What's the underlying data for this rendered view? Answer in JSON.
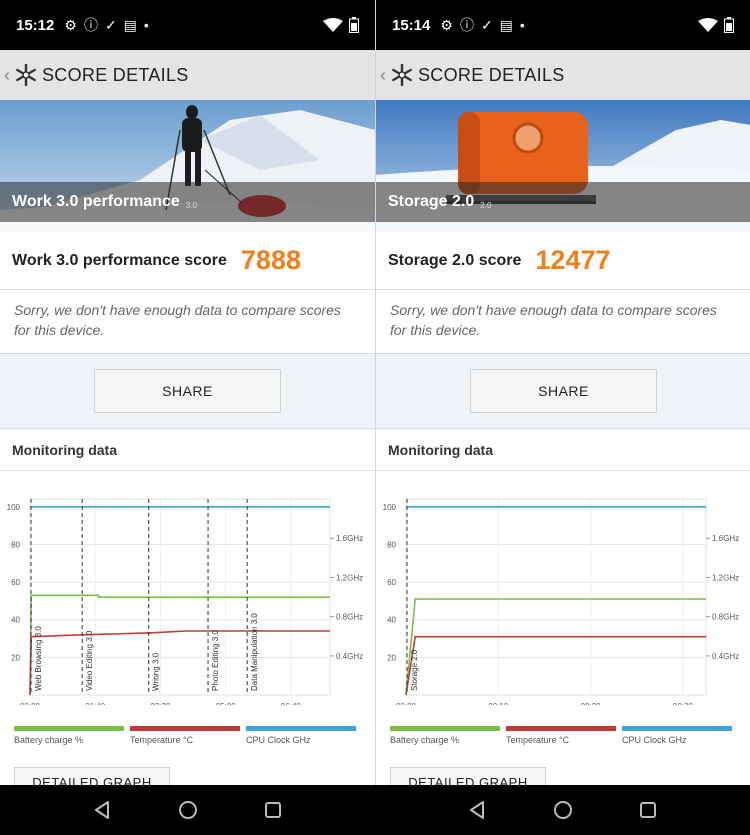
{
  "screens": [
    {
      "status": {
        "time": "15:12"
      },
      "appbar": {
        "title": "SCORE DETAILS"
      },
      "hero": {
        "name": "Work 3.0 performance",
        "version": "3.0"
      },
      "score": {
        "label": "Work 3.0 performance score",
        "value": "7888"
      },
      "compare_text": "Sorry, we don't have enough data to compare scores for this device.",
      "share_label": "SHARE",
      "monitoring": {
        "title": "Monitoring data",
        "detail_label": "DETAILED GRAPH"
      },
      "legend": [
        "Battery charge %",
        "Temperature °C",
        "CPU Clock GHz"
      ],
      "chart_data": {
        "type": "line",
        "x_ticks": [
          "00:00",
          "01:40",
          "03:20",
          "05:00",
          "06:40"
        ],
        "x_max_seconds": 460,
        "y_left_ticks": [
          "20",
          "40",
          "60",
          "80",
          "100"
        ],
        "y_right_ticks": [
          "0.4GHz",
          "0.8GHz",
          "1.2GHz",
          "1.6GHz"
        ],
        "ylim_left": [
          0,
          100
        ],
        "ylim_right_ghz": [
          0,
          2.0
        ],
        "markers": [
          {
            "label": "Web Browsing 3.0",
            "t": 0
          },
          {
            "label": "Video Editing 3.0",
            "t": 80
          },
          {
            "label": "Writing 3.0",
            "t": 182
          },
          {
            "label": "Photo Editing 3.0",
            "t": 273
          },
          {
            "label": "Data Manipulation 3.0",
            "t": 333
          }
        ],
        "series": [
          {
            "name": "Battery charge %",
            "color": "#7ac143",
            "points": [
              [
                0,
                0
              ],
              [
                2,
                53
              ],
              [
                105,
                53
              ],
              [
                105,
                52
              ],
              [
                460,
                52
              ]
            ]
          },
          {
            "name": "Temperature °C",
            "color": "#c23a3a",
            "points": [
              [
                0,
                0
              ],
              [
                2,
                31
              ],
              [
                80,
                32
              ],
              [
                182,
                33
              ],
              [
                240,
                34
              ],
              [
                460,
                34
              ]
            ]
          },
          {
            "name": "CPU Clock GHz",
            "color": "#3ba7d9",
            "points": [
              [
                0,
                100
              ],
              [
                460,
                100
              ]
            ]
          }
        ]
      }
    },
    {
      "status": {
        "time": "15:14"
      },
      "appbar": {
        "title": "SCORE DETAILS"
      },
      "hero": {
        "name": "Storage 2.0",
        "version": "2.0"
      },
      "score": {
        "label": "Storage 2.0 score",
        "value": "12477"
      },
      "compare_text": "Sorry, we don't have enough data to compare scores for this device.",
      "share_label": "SHARE",
      "monitoring": {
        "title": "Monitoring data",
        "detail_label": "DETAILED GRAPH"
      },
      "legend": [
        "Battery charge %",
        "Temperature °C",
        "CPU Clock GHz"
      ],
      "chart_data": {
        "type": "line",
        "x_ticks": [
          "00:00",
          "00:10",
          "00:20",
          "00:30"
        ],
        "x_max_seconds": 32.5,
        "y_left_ticks": [
          "20",
          "40",
          "60",
          "80",
          "100"
        ],
        "y_right_ticks": [
          "0.4GHz",
          "0.8GHz",
          "1.2GHz",
          "1.6GHz"
        ],
        "ylim_left": [
          0,
          100
        ],
        "ylim_right_ghz": [
          0,
          2.0
        ],
        "markers": [
          {
            "label": "Storage 2.0",
            "t": 0
          }
        ],
        "series": [
          {
            "name": "Battery charge %",
            "color": "#7ac143",
            "points": [
              [
                0,
                0
              ],
              [
                1,
                51
              ],
              [
                32.5,
                51
              ]
            ]
          },
          {
            "name": "Temperature °C",
            "color": "#c23a3a",
            "points": [
              [
                0,
                0
              ],
              [
                1,
                31
              ],
              [
                32.5,
                31
              ]
            ]
          },
          {
            "name": "CPU Clock GHz",
            "color": "#3ba7d9",
            "points": [
              [
                0,
                100
              ],
              [
                32.5,
                100
              ]
            ]
          }
        ]
      }
    }
  ],
  "colors": {
    "score_orange": "#f07f1d",
    "battery": "#7ac143",
    "temperature": "#c23a3a",
    "cpu": "#3ba7d9"
  }
}
